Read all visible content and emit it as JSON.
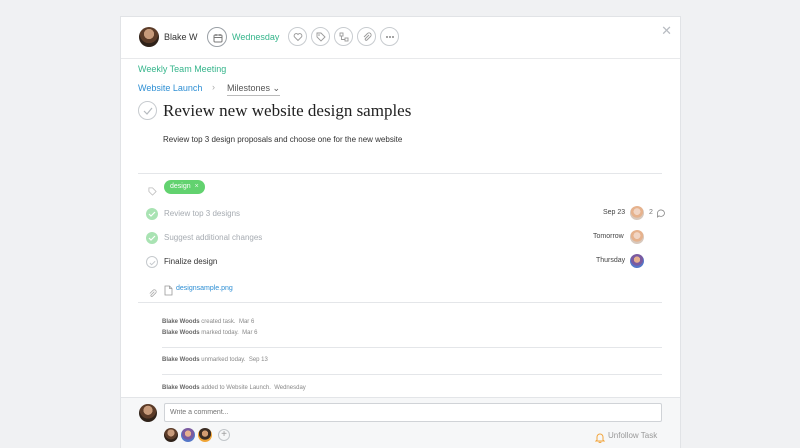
{
  "header": {
    "assignee_name": "Blake W",
    "due_label": "Wednesday"
  },
  "task": {
    "project": "Weekly Team Meeting",
    "breadcrumb_parent": "Website Launch",
    "breadcrumb_sep": "›",
    "breadcrumb_section": "Milestones ⌄",
    "title": "Review new website design samples",
    "description": "Review top 3 design proposals and choose one for the new website",
    "tags": [
      {
        "label": "design",
        "remove": "×",
        "color": "#62d26f"
      }
    ]
  },
  "subtasks": [
    {
      "label": "Review top 3 designs",
      "completed": true,
      "due": "Sep 23",
      "comment_count": "2"
    },
    {
      "label": "Suggest additional changes",
      "completed": true,
      "due": "Tomorrow",
      "comment_count": ""
    },
    {
      "label": "Finalize design",
      "completed": false,
      "due": "Thursday",
      "comment_count": ""
    }
  ],
  "attachment": {
    "name": "designsample.png"
  },
  "activity": [
    {
      "author": "Blake Woods",
      "action": "created task.",
      "date": "Mar 6"
    },
    {
      "author": "Blake Woods",
      "action": "marked today.",
      "date": "Mar 6"
    },
    {
      "author": "Blake Woods",
      "action": "unmarked today.",
      "date": "Sep 13"
    },
    {
      "author": "Blake Woods",
      "action": "added to Website Launch.",
      "date": "Wednesday"
    }
  ],
  "footer": {
    "comment_placeholder": "Write a comment...",
    "add_follower": "+",
    "unfollow_label": "Unfollow Task"
  },
  "icons": {
    "close": "close-icon",
    "calendar": "calendar-icon",
    "like": "heart-icon",
    "tag": "tag-icon",
    "subtask": "subtask-icon",
    "attach": "paperclip-icon",
    "more": "more-icon",
    "bell": "bell-icon"
  },
  "colors": {
    "accent_green": "#35b58b",
    "link_blue": "#2e8fd4",
    "tag_green": "#62d26f",
    "bell_orange": "#f2a53c"
  }
}
